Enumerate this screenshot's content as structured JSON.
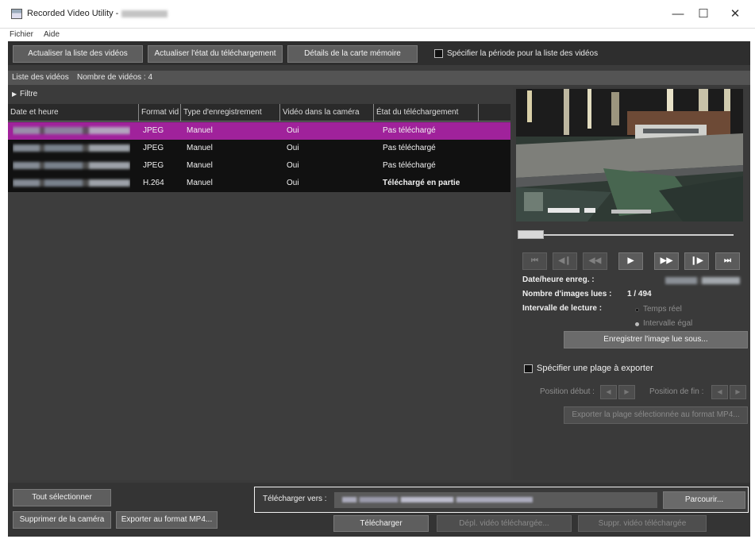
{
  "window": {
    "title": "Recorded Video Utility -",
    "minimize": "—",
    "maximize": "☐",
    "close": "✕"
  },
  "menu": {
    "file": "Fichier",
    "help": "Aide"
  },
  "toolbar": {
    "refresh_list": "Actualiser la liste des vidéos",
    "refresh_download_state": "Actualiser l'état du téléchargement",
    "memory_card_details": "Détails de la carte mémoire",
    "specify_period": "Spécifier la période pour la liste des vidéos"
  },
  "video_list": {
    "title": "Liste des vidéos",
    "count_label": "Nombre de vidéos : 4",
    "filter": "Filtre",
    "columns": [
      "Date et heure",
      "Format vid",
      "Type d'enregistrement",
      "Vidéo dans la caméra",
      "État du téléchargement"
    ],
    "rows": [
      {
        "format": "JPEG",
        "type": "Manuel",
        "in_camera": "Oui",
        "status": "Pas téléchargé",
        "selected": true
      },
      {
        "format": "JPEG",
        "type": "Manuel",
        "in_camera": "Oui",
        "status": "Pas téléchargé",
        "selected": false
      },
      {
        "format": "JPEG",
        "type": "Manuel",
        "in_camera": "Oui",
        "status": "Pas téléchargé",
        "selected": false
      },
      {
        "format": "H.264",
        "type": "Manuel",
        "in_camera": "Oui",
        "status": "Téléchargé en partie",
        "selected": false
      }
    ]
  },
  "player": {
    "icons": [
      "skip-start-icon",
      "step-back-icon",
      "rewind-icon",
      "play-icon",
      "fast-forward-icon",
      "step-forward-icon",
      "skip-end-icon"
    ],
    "glyphs": [
      "⏮",
      "◀❙",
      "◀◀",
      "▶",
      "▶▶",
      "❙▶",
      "⏭"
    ],
    "record_datetime_label": "Date/heure enreg. :",
    "images_read_label": "Nombre d'images lues :",
    "images_read_value": "1 / 494",
    "playback_interval_label": "Intervalle de lecture :",
    "realtime": "Temps réel",
    "equal_interval": "Intervalle égal",
    "save_image": "Enregistrer l'image lue sous..."
  },
  "export": {
    "specify_range": "Spécifier une plage à exporter",
    "start_position": "Position début :",
    "end_position": "Position de fin :",
    "prev": "◀",
    "next": "▶",
    "export_range_mp4": "Exporter la plage sélectionnée au format MP4..."
  },
  "bottom": {
    "select_all": "Tout sélectionner",
    "delete_from_camera": "Supprimer de la caméra",
    "export_mp4": "Exporter au format MP4...",
    "download_to_label": "Télécharger vers :",
    "browse": "Parcourir...",
    "download": "Télécharger",
    "move_downloaded": "Dépl. vidéo téléchargée...",
    "delete_downloaded": "Suppr. vidéo téléchargée"
  }
}
